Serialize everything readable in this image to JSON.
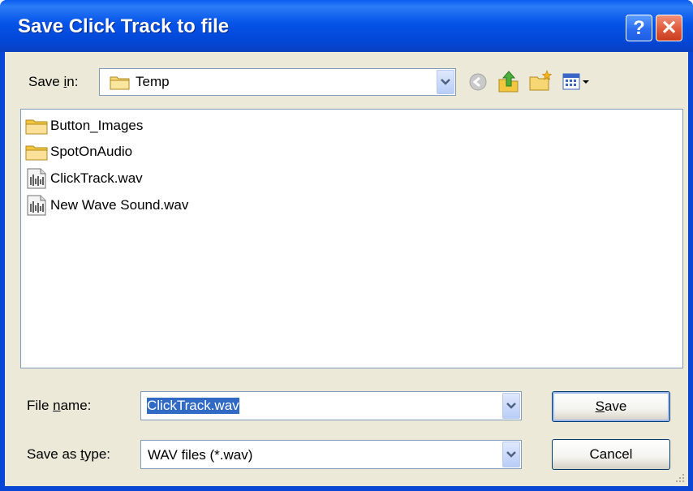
{
  "window": {
    "title": "Save Click Track to file"
  },
  "titlebar_buttons": {
    "help": "?",
    "close": "✕"
  },
  "save_in": {
    "label_pre": "Save ",
    "label_ul": "i",
    "label_post": "n:",
    "value": "Temp",
    "toolbar_icons": [
      "back-icon",
      "up-folder-icon",
      "new-folder-icon",
      "views-menu-icon"
    ]
  },
  "files": [
    {
      "name": "Button_Images",
      "type": "folder"
    },
    {
      "name": "SpotOnAudio",
      "type": "folder"
    },
    {
      "name": "ClickTrack.wav",
      "type": "wav"
    },
    {
      "name": "New Wave Sound.wav",
      "type": "wav"
    }
  ],
  "file_name": {
    "label_pre": "File ",
    "label_ul": "n",
    "label_post": "ame:",
    "value": "ClickTrack.wav"
  },
  "save_as_type": {
    "label_pre": "Save as ",
    "label_ul": "t",
    "label_post": "ype:",
    "value": "WAV files (*.wav)"
  },
  "buttons": {
    "save_ul": "S",
    "save_rest": "ave",
    "cancel": "Cancel"
  },
  "colors": {
    "title_bar": "#0553e8",
    "face": "#ece9d8",
    "selection": "#316ac5",
    "close": "#e0593a"
  }
}
